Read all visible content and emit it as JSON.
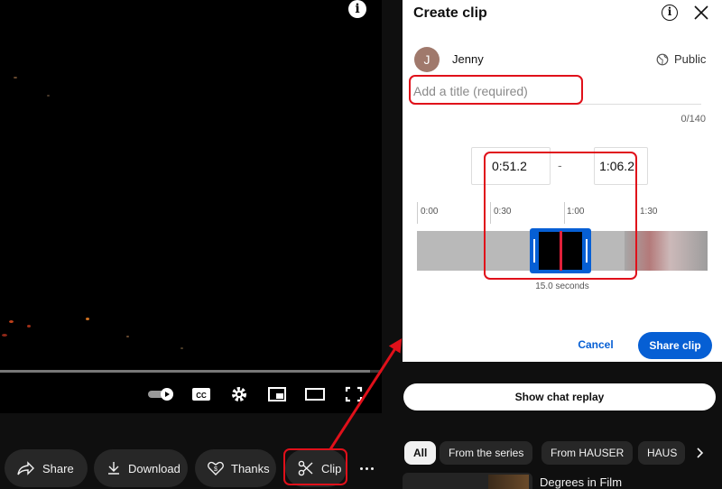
{
  "player": {
    "progress_fraction": 0.97,
    "controls": [
      "autoplay-toggle",
      "subtitles-cc",
      "settings-gear",
      "miniplayer",
      "theater-mode",
      "fullscreen"
    ],
    "info_icon": "i"
  },
  "actions": {
    "share_label": "Share",
    "download_label": "Download",
    "thanks_label": "Thanks",
    "clip_label": "Clip",
    "more_icon": "more-horizontal-icon"
  },
  "clip_panel": {
    "title": "Create clip",
    "info_icon": "i",
    "user_initial": "J",
    "user_name": "Jenny",
    "visibility": "Public",
    "title_placeholder": "Add a title (required)",
    "char_count": "0/140",
    "start_time": "0:51.2",
    "end_time": "1:06.2",
    "dash": "-",
    "ticks": [
      "0:00",
      "0:30",
      "1:00",
      "1:30"
    ],
    "duration": "15.0 seconds",
    "cancel_label": "Cancel",
    "share_clip_label": "Share clip"
  },
  "chat_replay_label": "Show chat replay",
  "chips": [
    "All",
    "From the series",
    "From HAUSER",
    "HAUS"
  ],
  "recommendation_title": "Degrees in Film",
  "colors": {
    "accent": "#065fd4",
    "annotation": "#e0101a",
    "background": "#0f0f0f"
  }
}
